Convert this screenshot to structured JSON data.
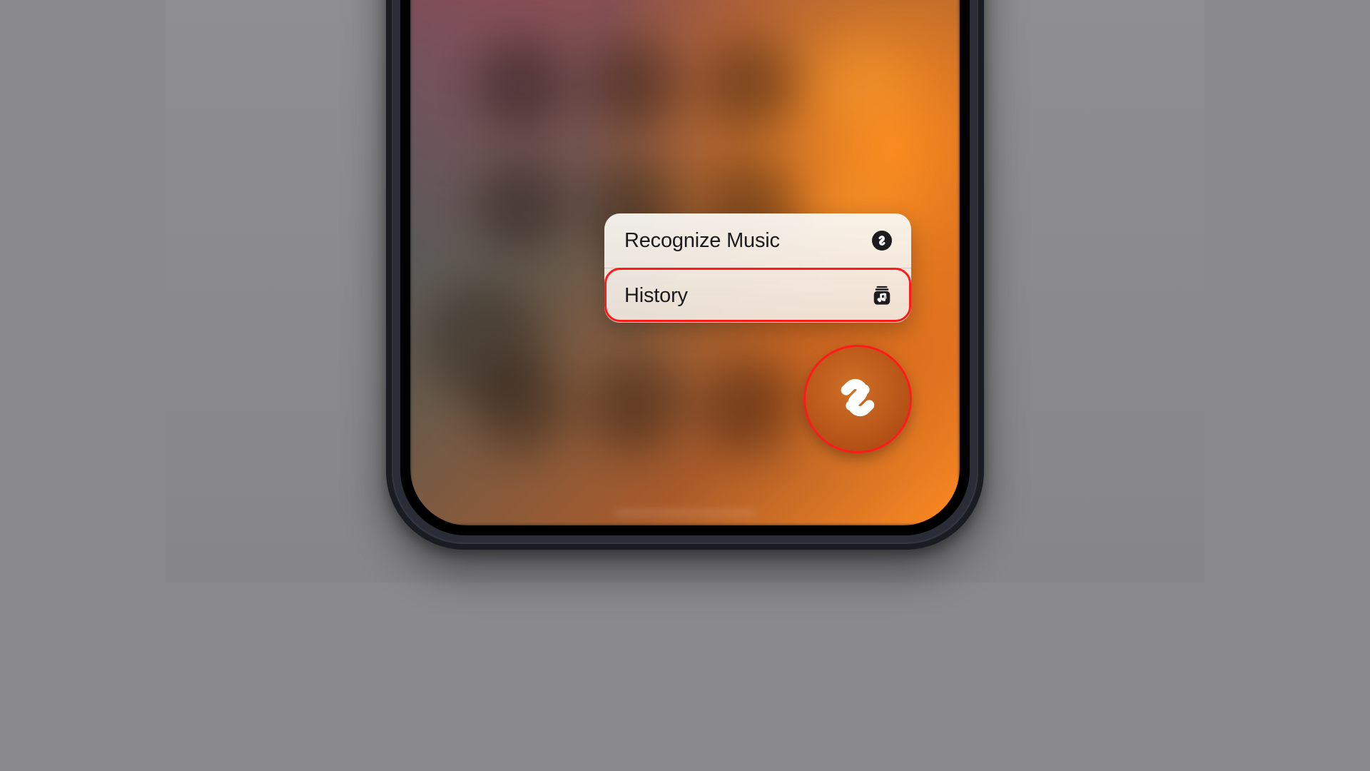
{
  "menu": {
    "items": [
      {
        "label": "Recognize Music",
        "icon": "shazam-icon"
      },
      {
        "label": "History",
        "icon": "music-library-icon"
      }
    ]
  },
  "annotations": {
    "history_highlighted": true,
    "shazam_button_highlighted": true,
    "highlight_color": "#ff1a1a"
  },
  "button": {
    "name": "Shazam",
    "color_bg": "#b65318",
    "color_fg": "#ffffff"
  }
}
